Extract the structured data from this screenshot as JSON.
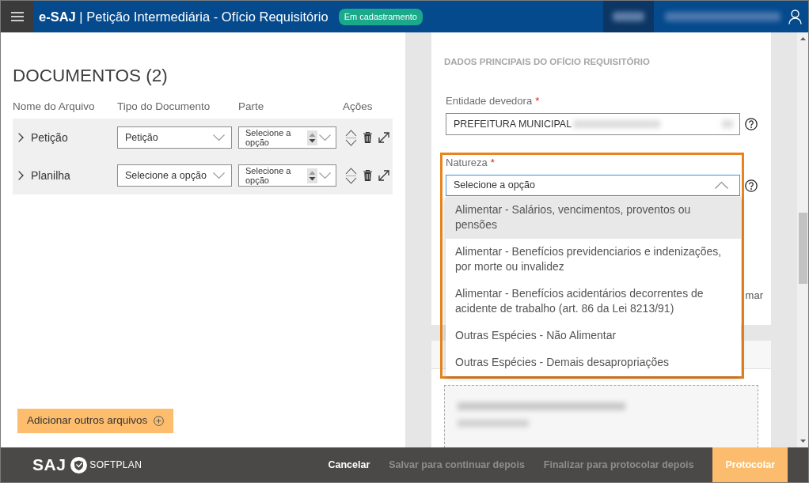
{
  "header": {
    "title": "**e-SAJ** | Petição Intermediária - Ofício Requisitório",
    "status_badge": "Em cadastramento"
  },
  "documents": {
    "heading": "DOCUMENTOS (2)",
    "columns": [
      "Nome do Arquivo",
      "Tipo do Documento",
      "Parte",
      "Ações"
    ],
    "rows": [
      {
        "name": "Petição",
        "expanded": false,
        "document_type": {
          "value": "Petição",
          "expanded": false
        },
        "party": {
          "value": "Selecione a opção",
          "expanded": false
        }
      },
      {
        "name": "Planilha",
        "expanded": false,
        "document_type": {
          "value": "Selecione a opção",
          "expanded": false
        },
        "party": {
          "value": "Selecione a opção",
          "expanded": false
        }
      }
    ],
    "add_button": "Adicionar outros arquivos"
  },
  "main_data": {
    "title": "DADOS PRINCIPAIS DO OFÍCIO REQUISITÓRIO",
    "fields": [
      {
        "kind": "text",
        "label": "Entidade devedora",
        "required_mark": "*",
        "value": "PREFEITURA MUNICIPAL",
        "redacted": true
      },
      {
        "kind": "select",
        "label": "Natureza",
        "required_mark": "*",
        "value": "Selecione a opção",
        "expanded": true,
        "options": [
          {
            "label": "Alimentar - Salários, vencimentos, proventos ou pensões",
            "selected": true
          },
          {
            "label": "Alimentar - Benefícios previdenciarios e indenizações, por morte ou invalidez",
            "selected": false
          },
          {
            "label": "Alimentar - Benefícios acidentários decorrentes de acidente de trabalho (art. 86 da Lei 8213/91)",
            "selected": false
          },
          {
            "label": "Outras Espécies - Não Alimentar",
            "selected": false
          },
          {
            "label": "Outras Espécies - Demais desapropriações",
            "selected": false
          }
        ]
      }
    ],
    "covered_text": "mar"
  },
  "footer": {
    "logo_text": "SAJ",
    "brand": "SOFTPLAN",
    "buttons": [
      {
        "label": "Cancelar",
        "kind": "secondary",
        "disabled": false
      },
      {
        "label": "Salvar para continuar depois",
        "kind": "secondary",
        "disabled": true
      },
      {
        "label": "Finalizar para protocolar depois",
        "kind": "secondary",
        "disabled": true
      },
      {
        "label": "Protocolar",
        "kind": "primary",
        "disabled": false
      }
    ]
  }
}
